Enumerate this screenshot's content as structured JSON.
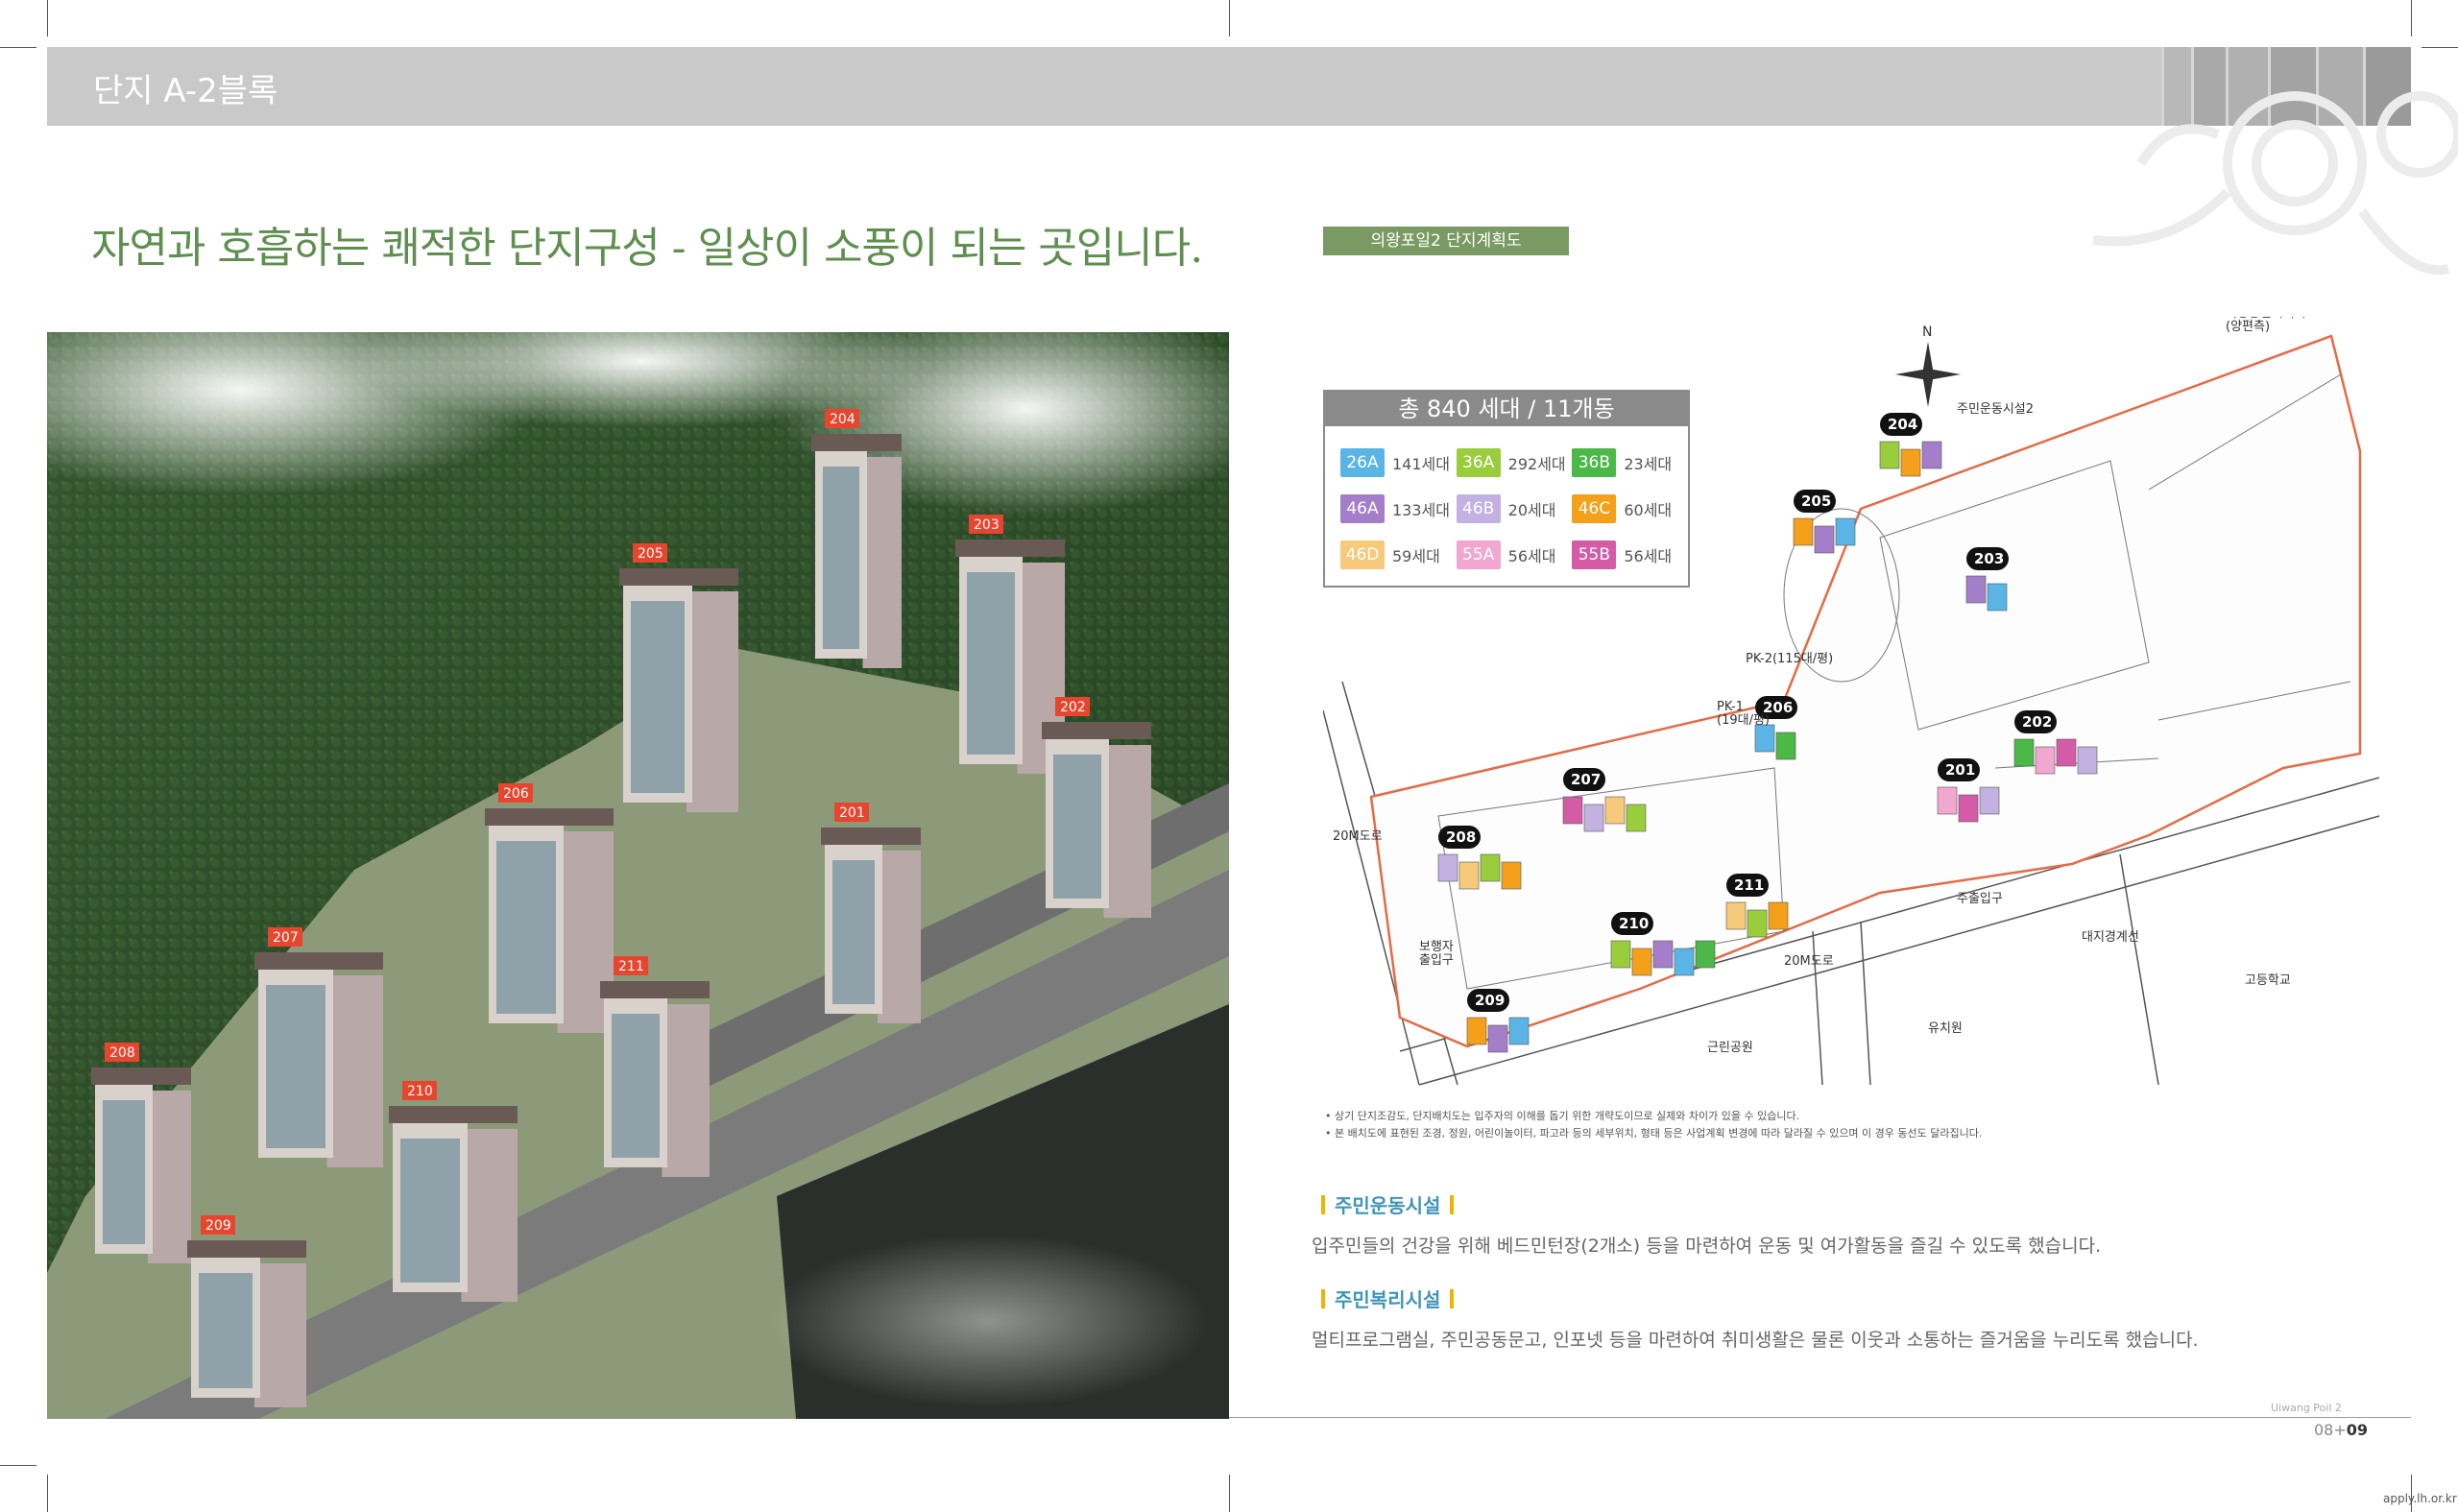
{
  "header": {
    "title": "단지 A-2블록",
    "stripe_colors": [
      "#b8b8b8",
      "#a9a9a9",
      "#b0b0b0",
      "#a3a3a3",
      "#adadad",
      "#9a9a9a"
    ]
  },
  "headline": "자연과 호흡하는 쾌적한 단지구성 - 일상이 소풍이 되는 곳입니다.",
  "photo": {
    "buildings": [
      {
        "label": "204"
      },
      {
        "label": "205"
      },
      {
        "label": "203"
      },
      {
        "label": "202"
      },
      {
        "label": "206"
      },
      {
        "label": "201"
      },
      {
        "label": "207"
      },
      {
        "label": "211"
      },
      {
        "label": "208"
      },
      {
        "label": "210"
      },
      {
        "label": "209"
      }
    ]
  },
  "plan_tag": "의왕포일2 단지계획도",
  "legend": {
    "title": "총 840 세대 / 11개동",
    "rows": [
      [
        {
          "type": "26A",
          "count": "141세대",
          "color": "#5ab4e6"
        },
        {
          "type": "36A",
          "count": "292세대",
          "color": "#9acd3c"
        },
        {
          "type": "36B",
          "count": "23세대",
          "color": "#4cb848"
        }
      ],
      [
        {
          "type": "46A",
          "count": "133세대",
          "color": "#a47ec8"
        },
        {
          "type": "46B",
          "count": "20세대",
          "color": "#c3b1e1"
        },
        {
          "type": "46C",
          "count": "60세대",
          "color": "#f5a01a"
        }
      ],
      [
        {
          "type": "46D",
          "count": "59세대",
          "color": "#f7c97a"
        },
        {
          "type": "55A",
          "count": "56세대",
          "color": "#f1a7cf"
        },
        {
          "type": "55B",
          "count": "56세대",
          "color": "#d45ca6"
        }
      ]
    ]
  },
  "site_plan": {
    "compass": "N",
    "building_labels": [
      "204",
      "205",
      "203",
      "206",
      "202",
      "201",
      "207",
      "208",
      "211",
      "210",
      "209"
    ],
    "place_labels": {
      "road_20m_left": "20M도로",
      "road_20m_bottom": "20M도로",
      "park": "근린공원",
      "kindergarten": "유치원",
      "high_school": "고등학교",
      "main_entrance": "주출입구",
      "boundary": "대지경계선",
      "sub_entrance": "보행자\n출입구",
      "pk1": "PK-1\n(19대/평)",
      "pk2": "PK-2(115대/평)",
      "top_right": "의왕통신기지국\n(양편측)",
      "plaza": "주민운동시설2"
    }
  },
  "notes": [
    "• 상기 단지조감도, 단지배치도는 입주자의 이해를 돕기 위한 개략도이므로 실제와 차이가 있을 수 있습니다.",
    "• 본 배치도에 표현된 조경, 정원, 어린이놀이터, 파고라 등의 세부위치, 형태 등은 사업계획 변경에 따라 달라질 수 있으며 이 경우 동선도 달라집니다."
  ],
  "sections": [
    {
      "title": "주민운동시설",
      "body": "입주민들의 건강을 위해 베드민턴장(2개소) 등을 마련하여 운동 및 여가활동을 즐길 수 있도록 했습니다."
    },
    {
      "title": "주민복리시설",
      "body": "멀티프로그램실, 주민공동문고, 인포넷 등을 마련하여 취미생활은 물론 이웃과 소통하는 즐거움을 누리도록 했습니다."
    }
  ],
  "footer": {
    "brand": "Uiwang Poil 2",
    "page_prefix": "08+",
    "page_current": "09"
  },
  "watermark": "apply.lh.or.kr"
}
